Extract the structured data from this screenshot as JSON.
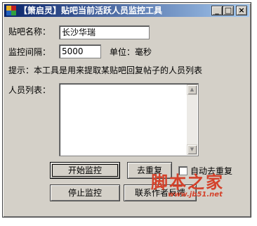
{
  "window": {
    "title": "【箫启灵】贴吧当前活跃人员监控工具",
    "controls": {
      "minimize": "_",
      "maximize": "□",
      "close": "×"
    }
  },
  "form": {
    "tieba_name_label": "贴吧名称：",
    "tieba_name_value": "长沙华瑞",
    "interval_label": "监控间隔：",
    "interval_value": "5000",
    "unit_label": "单位：毫秒",
    "hint_text": "提示：本工具是用来提取某贴吧回复帖子的人员列表",
    "member_list_label": "人员列表：",
    "member_list_items": []
  },
  "buttons": {
    "start_monitor": "开始监控",
    "dedupe": "去重复",
    "auto_dedupe": "自动去重复",
    "stop_monitor": "停止监控",
    "contact_author": "联系作者反馈"
  },
  "watermark": {
    "text": "脚本之家",
    "url": "www.jb51.net"
  },
  "colors": {
    "window_face": "#d4d0c8",
    "titlebar_start": "#0a246a",
    "titlebar_end": "#a6caf0",
    "watermark": "#d4412a"
  },
  "icons": [
    "app-icon",
    "minimize-icon",
    "maximize-icon",
    "close-icon",
    "scroll-up-icon",
    "scroll-down-icon"
  ]
}
